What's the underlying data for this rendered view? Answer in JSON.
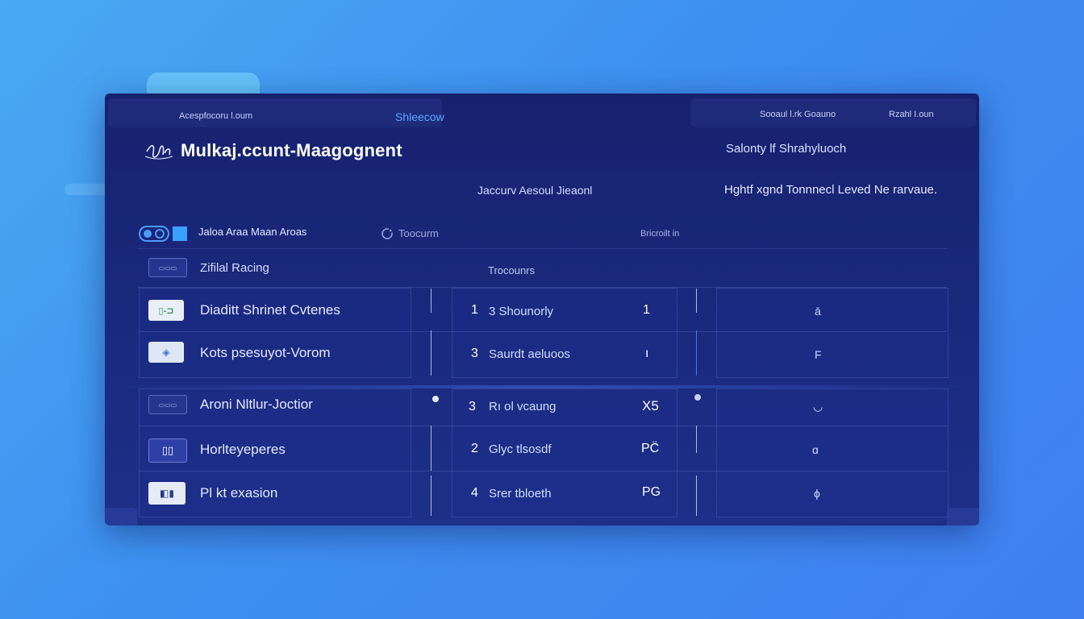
{
  "header": {
    "left_tab_label": "Acespfocoru l.oum",
    "center_tab_label": "Shleecow",
    "right_tab_label_1": "Sooaul l.rk Goauno",
    "right_tab_label_2": "Rzahl   I.oun"
  },
  "title": "Mulkaj.ccunt-Maagognent",
  "security_status": "Salonty lf Shrahyluoch",
  "security_label": "Jaccurv Aesoul Jieaonl",
  "notice": "Hghtf xgnd Tonnnecl Leved Ne rarvaue.",
  "toolbar": {
    "account_label": "Jaloa Araa Maan Aroas",
    "filter_label": "Toocurm",
    "search_label": "Bricroilt in"
  },
  "columns": {
    "name_header": "Zifilal Racing",
    "middle_header": "Trocounrs"
  },
  "rows": [
    {
      "label": "Diaditt Shrinet Cvtenes",
      "num": "1",
      "mid": "3  Shounorly",
      "mark": "1",
      "glyph": "ā"
    },
    {
      "label": "Kots psesuyot-Vorom",
      "num": "3",
      "mid": "Saurdt aeluoos",
      "mark": "ı",
      "glyph": "F"
    },
    {
      "label": "Aroni Nltlur-Joctior",
      "num": "3",
      "mid": "Rı ol  vcaung",
      "mark": "X5",
      "glyph": "◡"
    },
    {
      "label": "Horlteyeperes",
      "num": "2",
      "mid": "Glyc tlsosdf",
      "mark": "PC̈",
      "glyph": "ɑ"
    },
    {
      "label": "Pl kt   exasion",
      "num": "4",
      "mid": "Srer tbloeth",
      "mark": "PG",
      "glyph": "ϕ"
    }
  ],
  "colors": {
    "background_start": "#4aa9f2",
    "window": "#1b2a80",
    "accent": "#5aa8ff"
  }
}
